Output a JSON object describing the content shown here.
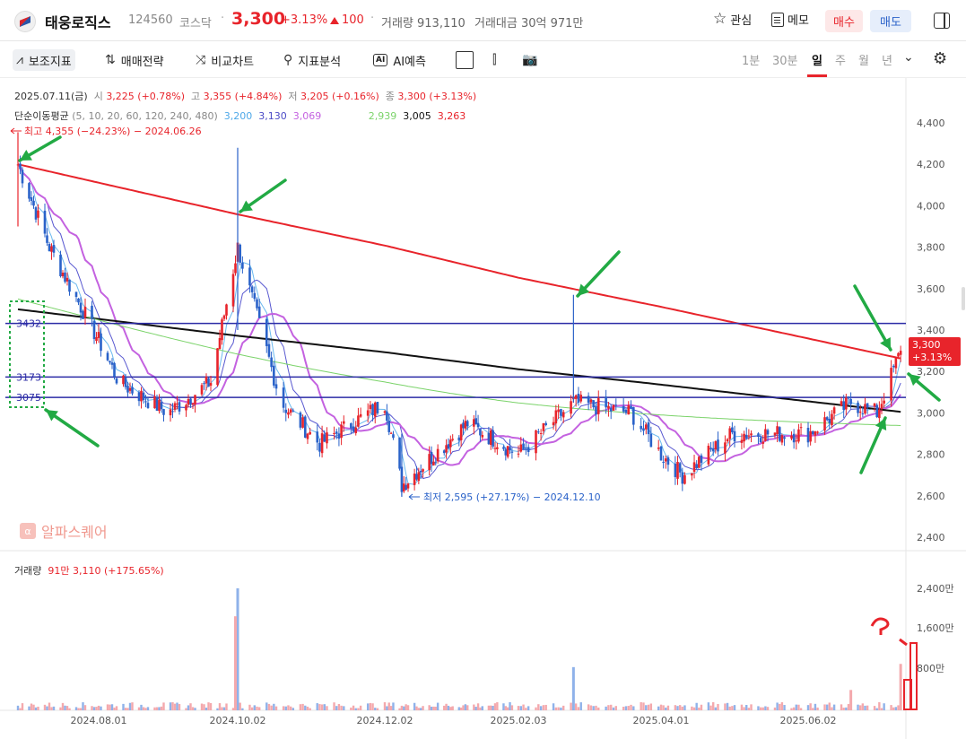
{
  "header": {
    "stock_name": "태웅로직스",
    "stock_code": "124560",
    "market": "코스닥",
    "separator": "·",
    "price": "3,300",
    "change_pct": "+3.13%",
    "change_abs": "100",
    "volume_text": "거래량 913,110",
    "amount_text": "거래대금 30억 971만",
    "watch_label": "관심",
    "memo_label": "메모",
    "buy_label": "매수",
    "sell_label": "매도"
  },
  "toolbar": {
    "indicator_label": "보조지표",
    "strategy_label": "매매전략",
    "compare_label": "비교차트",
    "analysis_label": "지표분석",
    "ai_label": "AI예측",
    "ai_badge": "AI",
    "periods": [
      "1분",
      "30분",
      "일",
      "주",
      "월",
      "년"
    ],
    "selected_period": "일"
  },
  "info": {
    "date": "2025.07.11(금)",
    "open_label": "시",
    "open": "3,225 (+0.78%)",
    "high_label": "고",
    "high": "3,355 (+4.84%)",
    "low_label": "저",
    "low": "3,205 (+0.16%)",
    "close_label": "종",
    "close": "3,300 (+3.13%)",
    "ma_label": "단순이동평균",
    "ma_periods": "(5, 10, 20, 60, 120, 240, 480)",
    "ma5": "3,200",
    "ma10": "3,130",
    "ma20": "3,069",
    "ma120": "2,939",
    "ma240": "3,005",
    "ma480": "3,263"
  },
  "volume_info": {
    "label": "거래량",
    "value": "91만 3,110 (+175.65%)"
  },
  "watermark": "알파스퀘어",
  "watermark_icon": "α",
  "price_tag": {
    "price": "3,300",
    "pct": "+3.13%"
  },
  "chart_data": {
    "type": "candlestick",
    "x_labels": [
      "2024.08.01",
      "2024.10.02",
      "2024.12.02",
      "2025.02.03",
      "2025.04.01",
      "2025.06.02"
    ],
    "y_ticks": [
      "4,400",
      "4,200",
      "4,000",
      "3,800",
      "3,600",
      "3,400",
      "3,200",
      "3,000",
      "2,800",
      "2,600",
      "2,400"
    ],
    "ylim": [
      2400,
      4400
    ],
    "volume_ticks": [
      "2,400만",
      "1,600만",
      "800만"
    ],
    "high_annotation": "최고 4,355 (−24.23%) − 2024.06.26",
    "low_annotation": "최저 2,595 (+27.17%) − 2024.12.10",
    "horizontal_lines": [
      {
        "value": 3432,
        "label": "3432"
      },
      {
        "value": 3173,
        "label": "3173"
      },
      {
        "value": 3075,
        "label": "3075"
      }
    ],
    "anchors": [
      {
        "date": "2024.06.26",
        "close": 4200
      },
      {
        "date": "2024.07.10",
        "close": 3800
      },
      {
        "date": "2024.08.01",
        "close": 3350
      },
      {
        "date": "2024.08.10",
        "close": 3150
      },
      {
        "date": "2024.09.01",
        "close": 3000
      },
      {
        "date": "2024.09.20",
        "close": 3150
      },
      {
        "date": "2024.10.02",
        "close": 3800
      },
      {
        "date": "2024.10.20",
        "close": 3050
      },
      {
        "date": "2024.11.05",
        "close": 2850
      },
      {
        "date": "2024.12.02",
        "close": 3050
      },
      {
        "date": "2024.12.10",
        "close": 2650
      },
      {
        "date": "2025.01.10",
        "close": 2950
      },
      {
        "date": "2025.02.03",
        "close": 2800
      },
      {
        "date": "2025.02.25",
        "close": 3050
      },
      {
        "date": "2025.03.20",
        "close": 3000
      },
      {
        "date": "2025.04.01",
        "close": 2800
      },
      {
        "date": "2025.04.10",
        "close": 2700
      },
      {
        "date": "2025.05.01",
        "close": 2900
      },
      {
        "date": "2025.06.02",
        "close": 2900
      },
      {
        "date": "2025.06.20",
        "close": 3050
      },
      {
        "date": "2025.07.01",
        "close": 3000
      },
      {
        "date": "2025.07.11",
        "close": 3300
      }
    ],
    "volume_spikes": [
      {
        "date": "2024.10.02",
        "volume": 2400,
        "color": "blue"
      },
      {
        "date": "2024.10.01",
        "volume": 1850,
        "color": "red"
      },
      {
        "date": "2025.02.25",
        "volume": 850,
        "color": "blue"
      },
      {
        "date": "2025.07.11",
        "volume": 913,
        "color": "red"
      },
      {
        "date": "2025.06.20",
        "volume": 400,
        "color": "red"
      }
    ],
    "moving_averages": [
      {
        "name": "480",
        "color": "#e8242b",
        "start": 4200,
        "end": 3263
      },
      {
        "name": "240",
        "color": "#111111",
        "start": 3500,
        "end": 3005
      },
      {
        "name": "120",
        "color": "#7bd36a",
        "start": 3550,
        "end": 2939
      }
    ]
  },
  "colors": {
    "up": "#e8242b",
    "down": "#2a62c9",
    "line": "#2b2ba6",
    "arrow": "#22aa44",
    "vol_up": "#f4a9ad",
    "vol_down": "#8fb2ea"
  }
}
